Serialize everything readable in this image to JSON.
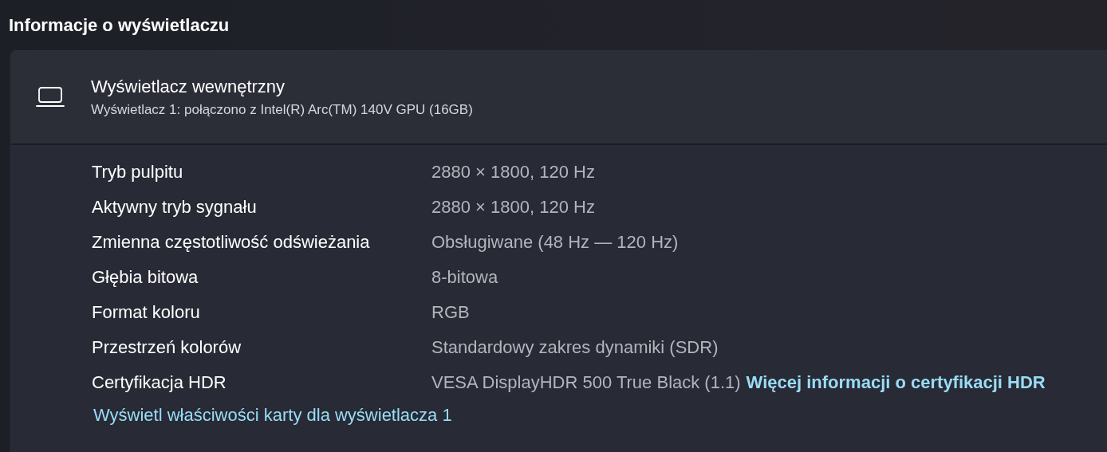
{
  "section_title": "Informacje o wyświetlaczu",
  "display": {
    "name": "Wyświetlacz wewnętrzny",
    "description": "Wyświetlacz 1: połączono z Intel(R) Arc(TM) 140V GPU (16GB)"
  },
  "properties": [
    {
      "label": "Tryb pulpitu",
      "value": "2880 × 1800, 120 Hz"
    },
    {
      "label": "Aktywny tryb sygnału",
      "value": "2880 × 1800, 120 Hz"
    },
    {
      "label": "Zmienna częstotliwość odświeżania",
      "value": "Obsługiwane (48 Hz — 120 Hz)"
    },
    {
      "label": "Głębia bitowa",
      "value": "8-bitowa"
    },
    {
      "label": "Format koloru",
      "value": "RGB"
    },
    {
      "label": "Przestrzeń kolorów",
      "value": "Standardowy zakres dynamiki (SDR)"
    },
    {
      "label": "Certyfikacja HDR",
      "value": "VESA DisplayHDR 500 True Black (1.1)",
      "link": "Więcej informacji o certyfikacji HDR"
    }
  ],
  "adapter_link": "Wyświetl właściwości karty dla wyświetlacza 1"
}
